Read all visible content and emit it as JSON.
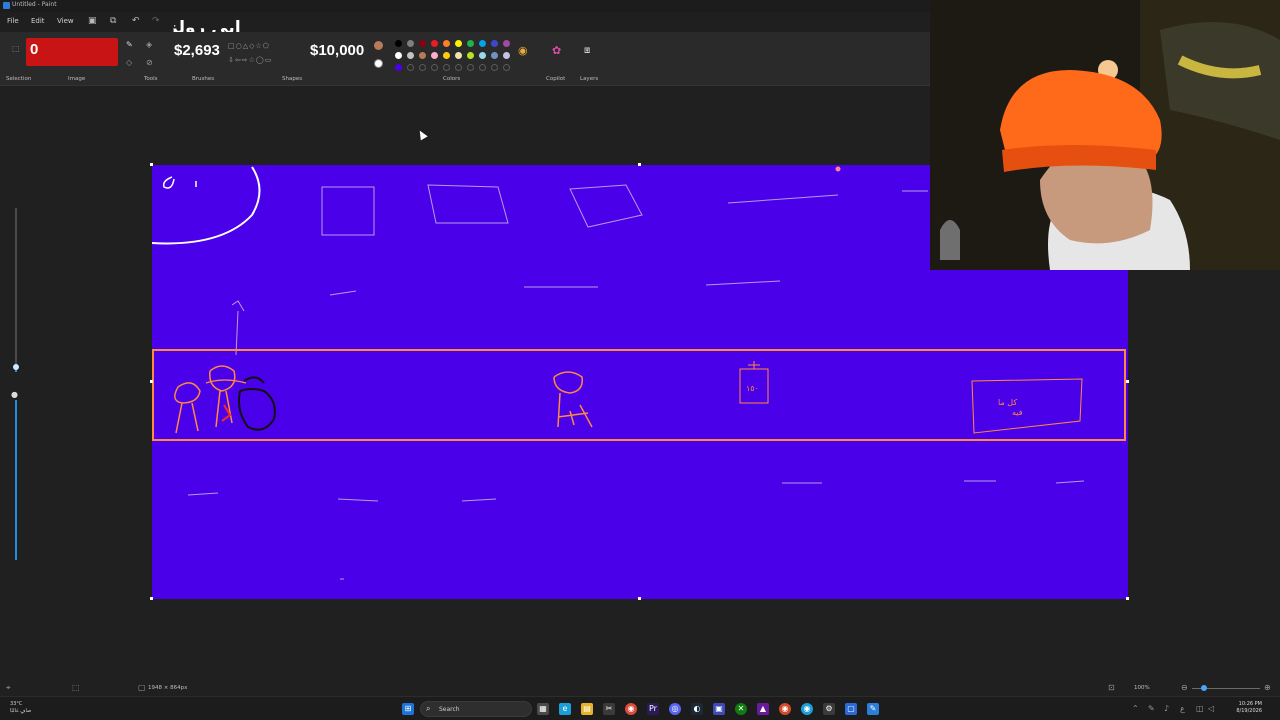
{
  "window": {
    "title": "Untitled - Paint",
    "overlay_name": "ابي رولز"
  },
  "menu": {
    "file": "File",
    "edit": "Edit",
    "view": "View"
  },
  "ribbon": {
    "counter": "0",
    "money_current": "$2,693",
    "money_goal": "$10,000",
    "groups": {
      "selection": "Selection",
      "image": "Image",
      "tools": "Tools",
      "brushes": "Brushes",
      "shapes": "Shapes",
      "colors": "Colors",
      "copilot": "Copilot",
      "layers": "Layers"
    },
    "palette": [
      "#000000",
      "#7f7f7f",
      "#880015",
      "#ed1c24",
      "#ff7f27",
      "#fff200",
      "#22b14c",
      "#00a2e8",
      "#3f48cc",
      "#a349a4",
      "#ffffff",
      "#c3c3c3",
      "#b97a57",
      "#ffaec9",
      "#ffc90e",
      "#efe4b0",
      "#b5e61d",
      "#99d9ea",
      "#7092be",
      "#c8bfe7"
    ],
    "primary_color": "#b97a57",
    "canvas_color": "#4b00ea"
  },
  "canvas": {
    "background": "#4b00ea",
    "road_border": "#ff8a3d",
    "box_text": "١٥٠",
    "sign_text": "كل ما\nفيه"
  },
  "statusbar": {
    "dimensions": "1948 × 864px",
    "zoom": "100%"
  },
  "taskbar": {
    "search_label": "Search",
    "weather_temp": "33°C",
    "weather_desc": "صافٍ غالبًا",
    "time": "10:26 PM",
    "date": "8/19/2026"
  }
}
